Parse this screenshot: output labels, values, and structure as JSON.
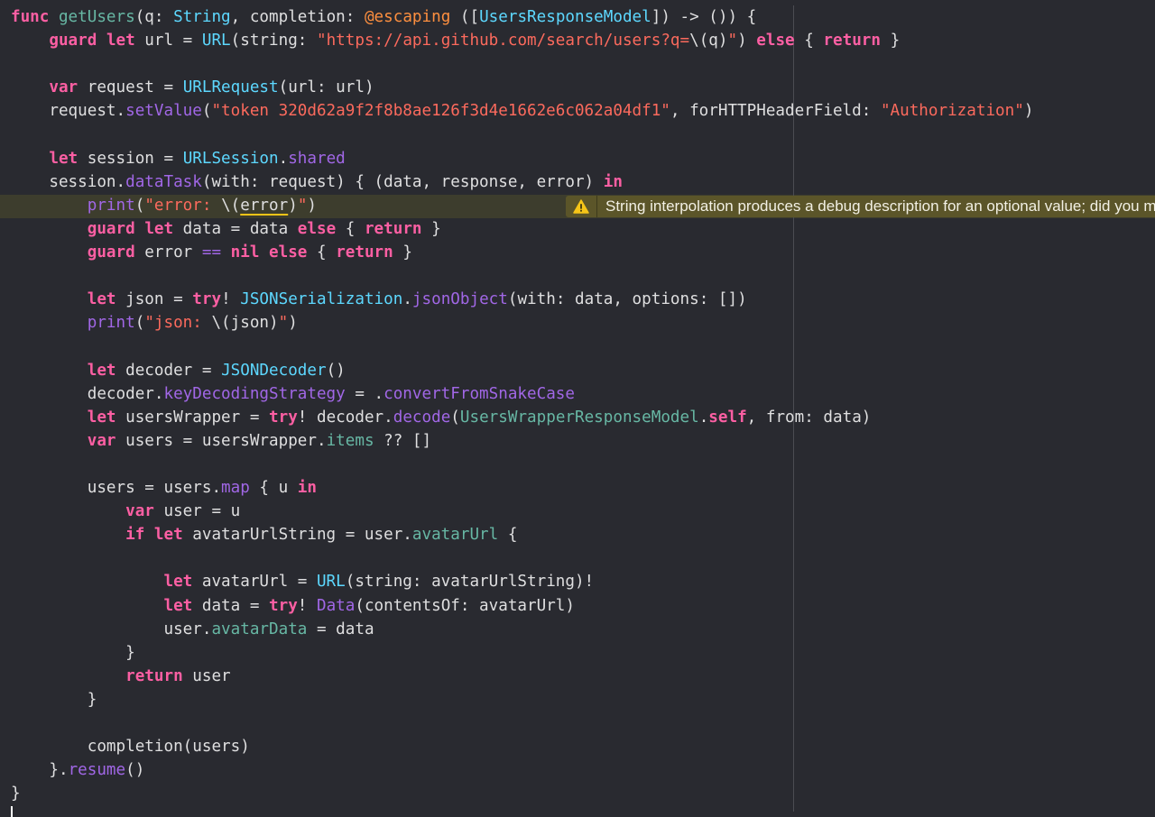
{
  "editor": {
    "lines": [
      [
        [
          "kw",
          "func"
        ],
        [
          "p",
          " "
        ],
        [
          "fn",
          "getUsers"
        ],
        [
          "p",
          "(q: "
        ],
        [
          "ty",
          "String"
        ],
        [
          "p",
          ", completion: "
        ],
        [
          "attr",
          "@escaping"
        ],
        [
          "p",
          " (["
        ],
        [
          "ty",
          "UsersResponseModel"
        ],
        [
          "p",
          "]) -> ()) {"
        ]
      ],
      [
        [
          "p",
          "    "
        ],
        [
          "kw",
          "guard"
        ],
        [
          "p",
          " "
        ],
        [
          "kw",
          "let"
        ],
        [
          "p",
          " url = "
        ],
        [
          "ty",
          "URL"
        ],
        [
          "p",
          "(string: "
        ],
        [
          "str",
          "\"https://api.github.com/search/users?q="
        ],
        [
          "p",
          "\\(q)"
        ],
        [
          "str",
          "\""
        ],
        [
          "p",
          ") "
        ],
        [
          "kw",
          "else"
        ],
        [
          "p",
          " { "
        ],
        [
          "kw",
          "return"
        ],
        [
          "p",
          " }"
        ]
      ],
      [],
      [
        [
          "p",
          "    "
        ],
        [
          "kw",
          "var"
        ],
        [
          "p",
          " request = "
        ],
        [
          "ty",
          "URLRequest"
        ],
        [
          "p",
          "(url: url)"
        ]
      ],
      [
        [
          "p",
          "    request."
        ],
        [
          "pr",
          "setValue"
        ],
        [
          "p",
          "("
        ],
        [
          "str",
          "\"token 320d62a9f2f8b8ae126f3d4e1662e6c062a04df1\""
        ],
        [
          "p",
          ", forHTTPHeaderField: "
        ],
        [
          "str",
          "\"Authorization\""
        ],
        [
          "p",
          ")"
        ]
      ],
      [],
      [
        [
          "p",
          "    "
        ],
        [
          "kw",
          "let"
        ],
        [
          "p",
          " session = "
        ],
        [
          "ty",
          "URLSession"
        ],
        [
          "p",
          "."
        ],
        [
          "pr",
          "shared"
        ]
      ],
      [
        [
          "p",
          "    session."
        ],
        [
          "pr",
          "dataTask"
        ],
        [
          "p",
          "(with: request) { (data, response, error) "
        ],
        [
          "kw",
          "in"
        ]
      ],
      [
        [
          "p",
          "        "
        ],
        [
          "pr",
          "print"
        ],
        [
          "p",
          "("
        ],
        [
          "str",
          "\"error: "
        ],
        [
          "p",
          "\\("
        ],
        [
          "err",
          "error"
        ],
        [
          "p",
          ")"
        ],
        [
          "str",
          "\""
        ],
        [
          "p",
          ")"
        ]
      ],
      [
        [
          "p",
          "        "
        ],
        [
          "kw",
          "guard"
        ],
        [
          "p",
          " "
        ],
        [
          "kw",
          "let"
        ],
        [
          "p",
          " data = data "
        ],
        [
          "kw",
          "else"
        ],
        [
          "p",
          " { "
        ],
        [
          "kw",
          "return"
        ],
        [
          "p",
          " }"
        ]
      ],
      [
        [
          "p",
          "        "
        ],
        [
          "kw",
          "guard"
        ],
        [
          "p",
          " error "
        ],
        [
          "pr",
          "=="
        ],
        [
          "p",
          " "
        ],
        [
          "kw",
          "nil"
        ],
        [
          "p",
          " "
        ],
        [
          "kw",
          "else"
        ],
        [
          "p",
          " { "
        ],
        [
          "kw",
          "return"
        ],
        [
          "p",
          " }"
        ]
      ],
      [],
      [
        [
          "p",
          "        "
        ],
        [
          "kw",
          "let"
        ],
        [
          "p",
          " json = "
        ],
        [
          "kw",
          "try"
        ],
        [
          "p",
          "! "
        ],
        [
          "ty",
          "JSONSerialization"
        ],
        [
          "p",
          "."
        ],
        [
          "pr",
          "jsonObject"
        ],
        [
          "p",
          "(with: data, options: [])"
        ]
      ],
      [
        [
          "p",
          "        "
        ],
        [
          "pr",
          "print"
        ],
        [
          "p",
          "("
        ],
        [
          "str",
          "\"json: "
        ],
        [
          "p",
          "\\(json)"
        ],
        [
          "str",
          "\""
        ],
        [
          "p",
          ")"
        ]
      ],
      [],
      [
        [
          "p",
          "        "
        ],
        [
          "kw",
          "let"
        ],
        [
          "p",
          " decoder = "
        ],
        [
          "ty",
          "JSONDecoder"
        ],
        [
          "p",
          "()"
        ]
      ],
      [
        [
          "p",
          "        decoder."
        ],
        [
          "pr",
          "keyDecodingStrategy"
        ],
        [
          "p",
          " = ."
        ],
        [
          "pr",
          "convertFromSnakeCase"
        ]
      ],
      [
        [
          "p",
          "        "
        ],
        [
          "kw",
          "let"
        ],
        [
          "p",
          " usersWrapper = "
        ],
        [
          "kw",
          "try"
        ],
        [
          "p",
          "! decoder."
        ],
        [
          "pr",
          "decode"
        ],
        [
          "p",
          "("
        ],
        [
          "fn",
          "UsersWrapperResponseModel"
        ],
        [
          "p",
          "."
        ],
        [
          "kw",
          "self"
        ],
        [
          "p",
          ", from: data)"
        ]
      ],
      [
        [
          "p",
          "        "
        ],
        [
          "kw",
          "var"
        ],
        [
          "p",
          " users = usersWrapper."
        ],
        [
          "mb",
          "items"
        ],
        [
          "p",
          " ?? []"
        ]
      ],
      [],
      [
        [
          "p",
          "        users = users."
        ],
        [
          "pr",
          "map"
        ],
        [
          "p",
          " { u "
        ],
        [
          "kw",
          "in"
        ]
      ],
      [
        [
          "p",
          "            "
        ],
        [
          "kw",
          "var"
        ],
        [
          "p",
          " user = u"
        ]
      ],
      [
        [
          "p",
          "            "
        ],
        [
          "kw",
          "if"
        ],
        [
          "p",
          " "
        ],
        [
          "kw",
          "let"
        ],
        [
          "p",
          " avatarUrlString = user."
        ],
        [
          "mb",
          "avatarUrl"
        ],
        [
          "p",
          " {"
        ]
      ],
      [],
      [
        [
          "p",
          "                "
        ],
        [
          "kw",
          "let"
        ],
        [
          "p",
          " avatarUrl = "
        ],
        [
          "ty",
          "URL"
        ],
        [
          "p",
          "(string: avatarUrlString)!"
        ]
      ],
      [
        [
          "p",
          "                "
        ],
        [
          "kw",
          "let"
        ],
        [
          "p",
          " data = "
        ],
        [
          "kw",
          "try"
        ],
        [
          "p",
          "! "
        ],
        [
          "ty2",
          "Data"
        ],
        [
          "p",
          "(contentsOf: avatarUrl)"
        ]
      ],
      [
        [
          "p",
          "                user."
        ],
        [
          "mb",
          "avatarData"
        ],
        [
          "p",
          " = data"
        ]
      ],
      [
        [
          "p",
          "            }"
        ]
      ],
      [
        [
          "p",
          "            "
        ],
        [
          "kw",
          "return"
        ],
        [
          "p",
          " user"
        ]
      ],
      [
        [
          "p",
          "        }"
        ]
      ],
      [],
      [
        [
          "p",
          "        completion(users)"
        ]
      ],
      [
        [
          "p",
          "    }."
        ],
        [
          "pr",
          "resume"
        ],
        [
          "p",
          "()"
        ]
      ],
      [
        [
          "p",
          "}"
        ]
      ]
    ],
    "warning": {
      "icon": "warning-triangle-icon",
      "message": "String interpolation produces a debug description for an optional value; did you mean to make this explicit?"
    },
    "colors": {
      "background": "#292a30",
      "keyword": "#fc5fa3",
      "string": "#fc6a5d",
      "type": "#5dd8ff",
      "function": "#67b7a4",
      "property": "#a167e6",
      "attribute": "#fd8f3f",
      "warning_banner": "#5b5529"
    }
  }
}
